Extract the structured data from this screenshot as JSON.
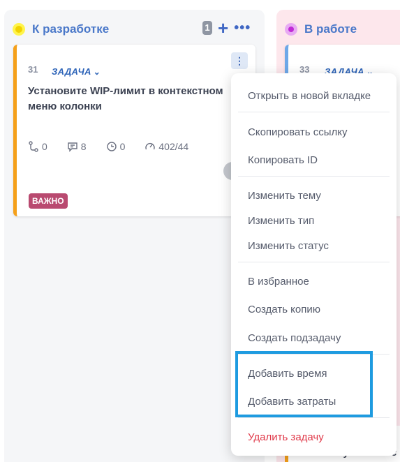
{
  "columns": [
    {
      "title": "К разработке",
      "status_color": "#f2d100",
      "task_count": "1"
    },
    {
      "title": "В работе",
      "status_color": "#c02bd6"
    }
  ],
  "task_card": {
    "id": "31",
    "type": "ЗАДАЧА",
    "title": "Установите WIP-лимит в контекстном меню колонки",
    "stats": {
      "subtasks": "0",
      "comments": "8",
      "time": "0",
      "progress": "402/44"
    },
    "tag": "ВАЖНО",
    "accent_color": "#f5a01a"
  },
  "task_card_2": {
    "id": "33",
    "type": "ЗАДАЧА",
    "accent_color": "#6ea8e8"
  },
  "bottom_card_text": "Используйте \"Спис",
  "context_menu": {
    "open_new_tab": "Открыть в новой вкладке",
    "copy_link": "Скопировать ссылку",
    "copy_id": "Копировать ID",
    "change_topic": "Изменить тему",
    "change_type": "Изменить тип",
    "change_status": "Изменить статус",
    "add_favorite": "В избранное",
    "create_copy": "Создать копию",
    "create_subtask": "Создать подзадачу",
    "add_time": "Добавить время",
    "add_costs": "Добавить затраты",
    "delete_task": "Удалить задачу"
  },
  "colors": {
    "highlight": "#1e9be0",
    "danger": "#e03a4a",
    "tag_important": "#b94a70"
  }
}
